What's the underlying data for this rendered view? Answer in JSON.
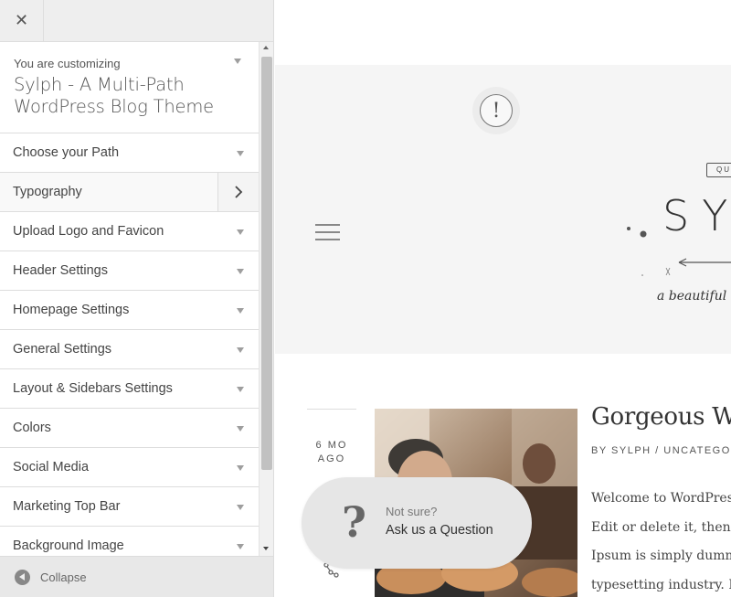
{
  "sidebar": {
    "close_symbol": "✕",
    "info": {
      "small": "You are customizing",
      "title_line1": "Sylph - A Multi-Path",
      "title_line2": "WordPress Blog Theme"
    },
    "sections": [
      {
        "label": "Choose your Path"
      },
      {
        "label": "Typography"
      },
      {
        "label": "Upload Logo and Favicon"
      },
      {
        "label": "Header Settings"
      },
      {
        "label": "Homepage Settings"
      },
      {
        "label": "General Settings"
      },
      {
        "label": "Layout & Sidebars Settings"
      },
      {
        "label": "Colors"
      },
      {
        "label": "Social Media"
      },
      {
        "label": "Marketing Top Bar"
      },
      {
        "label": "Background Image"
      }
    ],
    "collapse_label": "Collapse"
  },
  "preview": {
    "alert_symbol": "!",
    "logo_badge": "QU",
    "logo_text": "SY",
    "tagline": "a beautiful bl",
    "post": {
      "date_line1": "6 MO",
      "date_line2": "AGO",
      "title": "Gorgeous Wo",
      "meta": "BY SYLPH / UNCATEGO",
      "body": [
        "Welcome to WordPress",
        "Edit or delete it, then",
        "Ipsum is simply dummy",
        "typesetting industry. Lor"
      ]
    }
  },
  "help": {
    "symbol": "?",
    "small": "Not sure?",
    "big": "Ask us a Question"
  },
  "colors": {
    "sidebar_bg": "#eeeeee",
    "header_area_bg": "#f5f5f5",
    "help_bubble_bg": "#e6e6e6"
  }
}
